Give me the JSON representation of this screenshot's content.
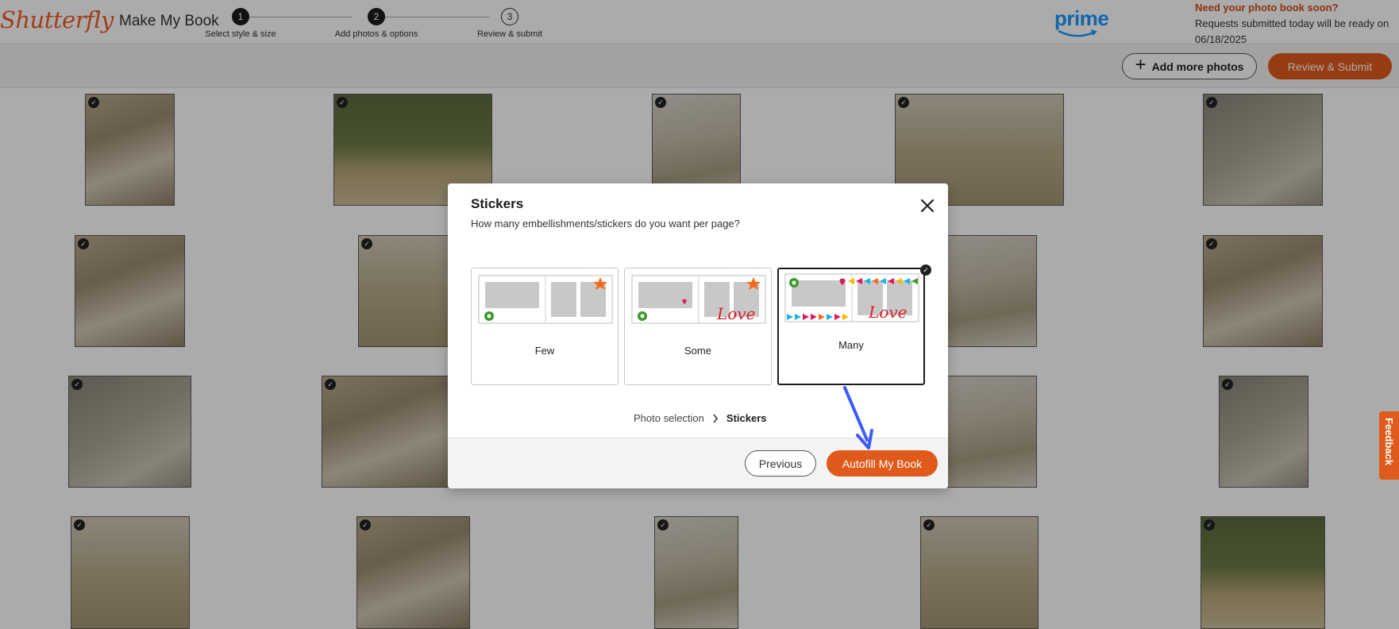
{
  "header": {
    "logo": "Shutterfly",
    "app_title": "Make My Book",
    "steps": [
      {
        "number": "1",
        "label": "Select style & size"
      },
      {
        "number": "2",
        "label": "Add photos & options"
      },
      {
        "number": "3",
        "label": "Review & submit"
      }
    ],
    "prime_logo": "prime",
    "promo_title": "Need your photo book soon?",
    "promo_text_line1": "Requests submitted today will be ready on",
    "promo_text_line2": "06/18/2025"
  },
  "toolbar": {
    "add_photos_label": "Add more photos",
    "review_submit_label": "Review & Submit"
  },
  "dialog": {
    "title": "Stickers",
    "subtitle": "How many embellishments/stickers do you want per page?",
    "options": [
      {
        "label": "Few",
        "selected": false
      },
      {
        "label": "Some",
        "selected": false
      },
      {
        "label": "Many",
        "selected": true
      }
    ],
    "breadcrumb": [
      "Photo selection",
      "Stickers"
    ],
    "previous_label": "Previous",
    "autofill_label": "Autofill My Book",
    "sticker_text": "Love"
  },
  "feedback_label": "Feedback",
  "colors": {
    "brand": "#f05a28",
    "accent_button": "#e05a1c",
    "prime": "#1a98ff",
    "annotation_arrow": "#3b5bff"
  }
}
